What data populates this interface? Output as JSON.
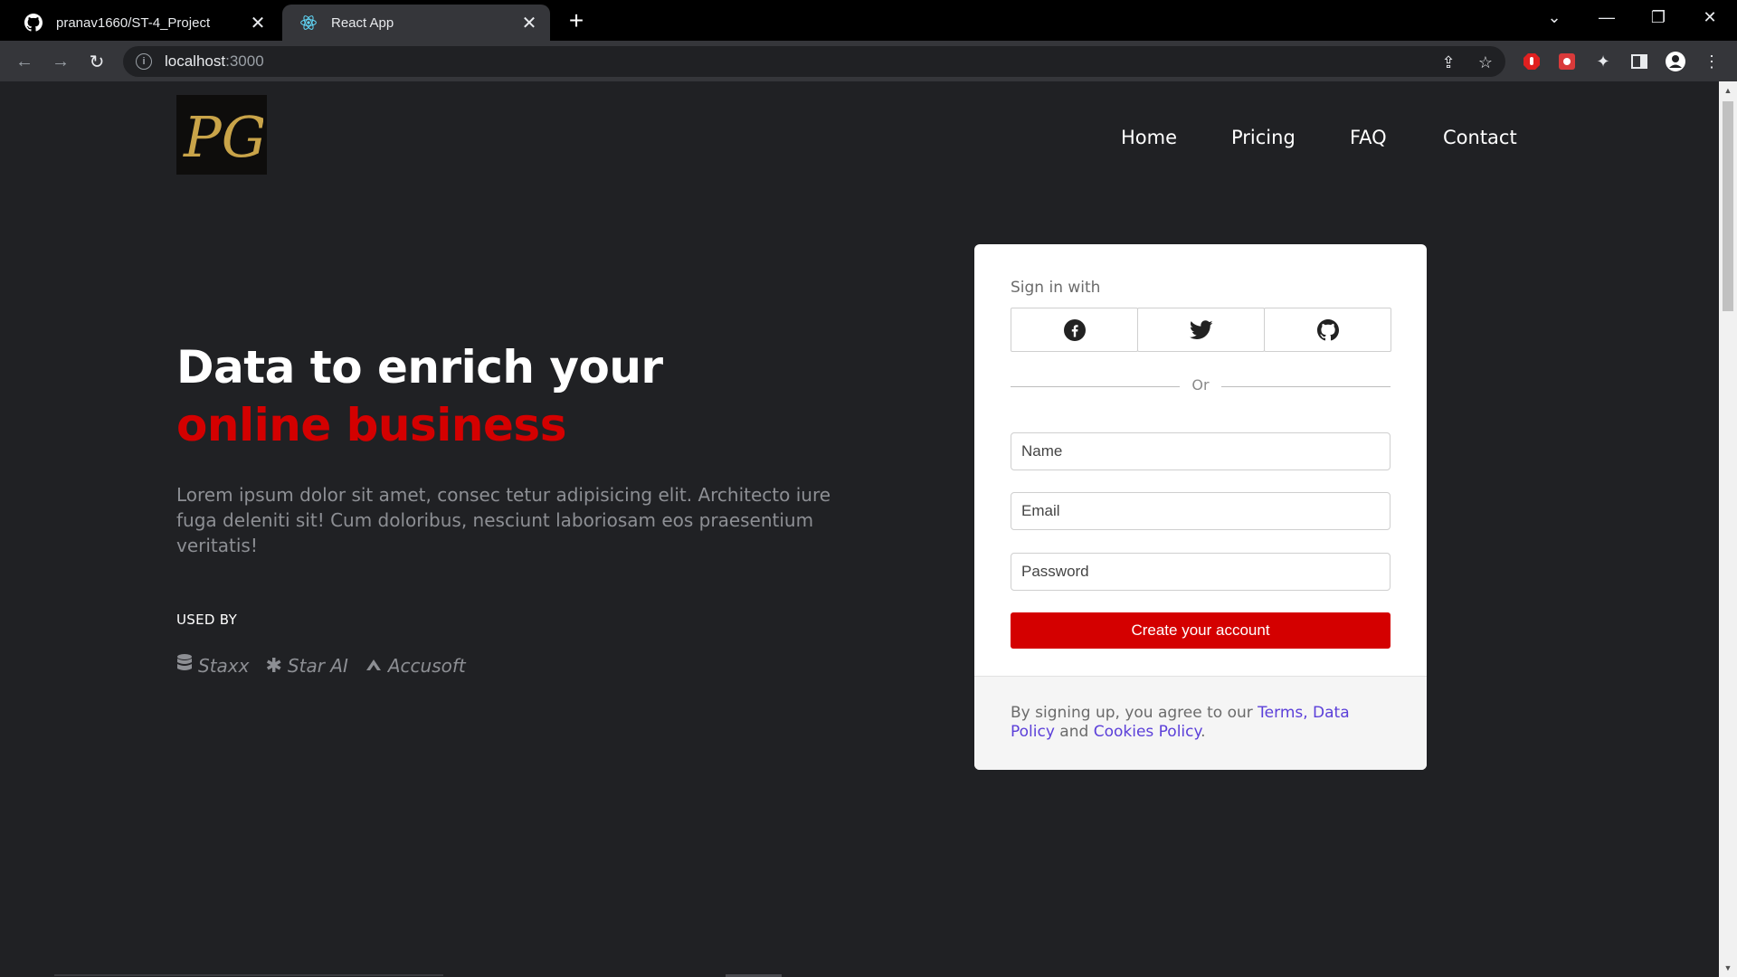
{
  "browser": {
    "tabs": [
      {
        "title": "pranav1660/ST-4_Project",
        "icon": "github-icon",
        "active": false
      },
      {
        "title": "React App",
        "icon": "react-icon",
        "active": true
      }
    ],
    "url_host": "localhost",
    "url_port": ":3000"
  },
  "nav": {
    "logo_text": "PG",
    "links": [
      "Home",
      "Pricing",
      "FAQ",
      "Contact"
    ]
  },
  "hero": {
    "title_line1": "Data to enrich your",
    "title_line2": "online business",
    "description": "Lorem ipsum dolor sit amet, consec tetur adipisicing elit. Architecto iure fuga deleniti sit! Cum doloribus, nesciunt laboriosam eos praesentium veritatis!",
    "used_by_label": "USED BY",
    "brands": [
      {
        "name": "Staxx",
        "icon": "database-icon"
      },
      {
        "name": "Star AI",
        "icon": "asterisk-icon"
      },
      {
        "name": "Accusoft",
        "icon": "accusoft-icon"
      }
    ],
    "accent_color": "#d40000"
  },
  "signup": {
    "sign_in_with": "Sign in with",
    "social": [
      "facebook-icon",
      "twitter-icon",
      "github-icon"
    ],
    "or": "Or",
    "name_placeholder": "Name",
    "email_placeholder": "Email",
    "password_placeholder": "Password",
    "submit_label": "Create your account",
    "terms_prefix": "By signing up, you agree to our ",
    "terms_link": "Terms, Data Policy",
    "terms_and": " and ",
    "cookies_link": "Cookies Policy",
    "terms_suffix": ".",
    "link_color": "#5b3fd9"
  }
}
